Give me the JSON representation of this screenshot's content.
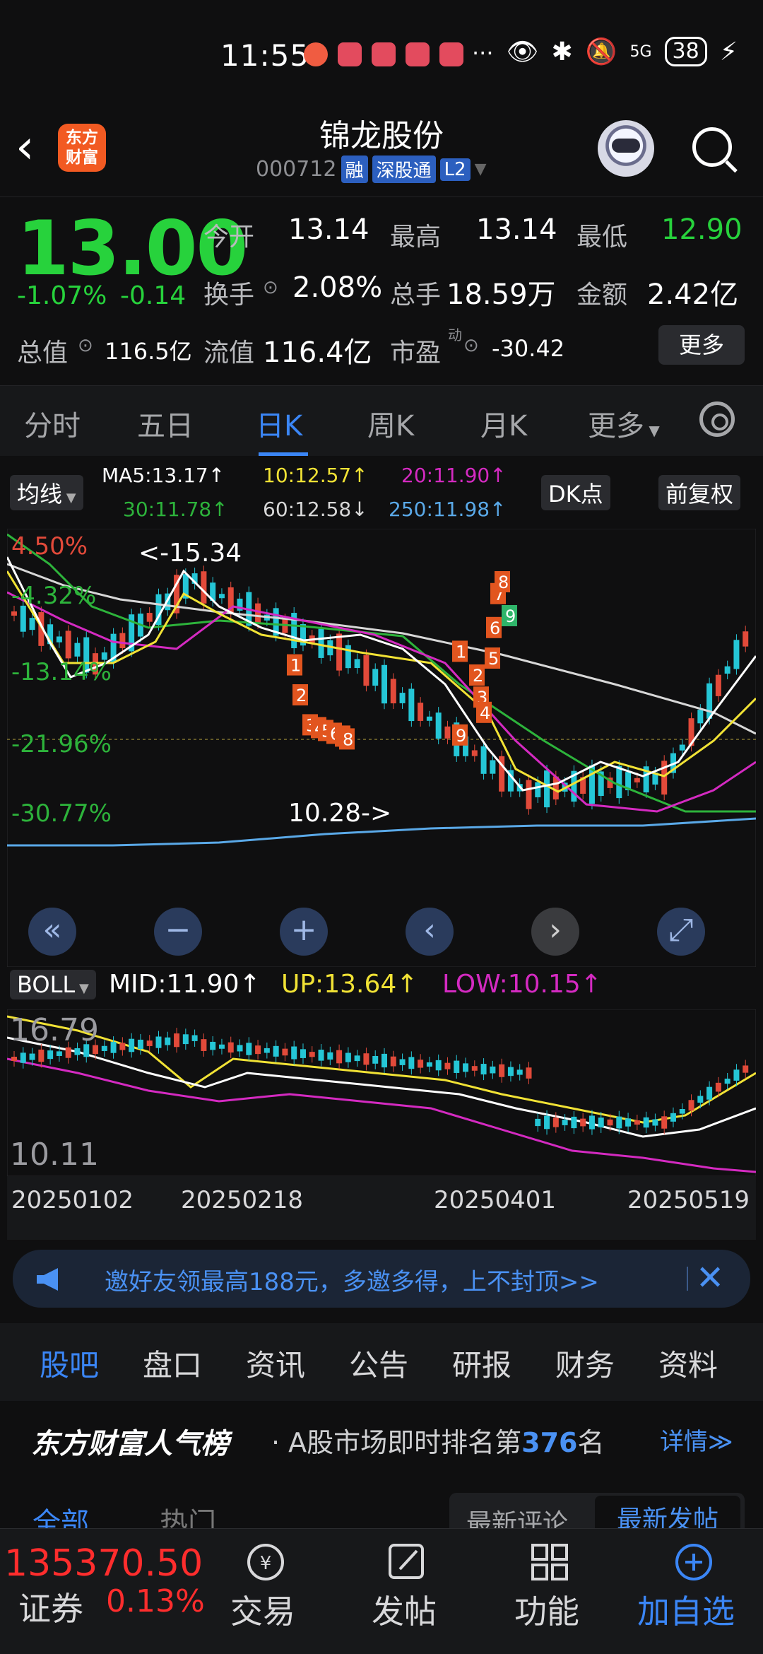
{
  "status": {
    "time": "11:55",
    "battery": "38",
    "network": "5G"
  },
  "header": {
    "brand_line1": "东方",
    "brand_line2": "财富",
    "title": "锦龙股份",
    "code": "000712",
    "tags": [
      "融",
      "深股通",
      "L2"
    ]
  },
  "quote": {
    "price": "13.00",
    "change_pct": "-1.07%",
    "change_amt": "-0.14",
    "open_label": "今开",
    "open": "13.14",
    "high_label": "最高",
    "high": "13.14",
    "low_label": "最低",
    "low": "12.90",
    "turnover_label": "换手",
    "turnover": "2.08%",
    "volume_label": "总手",
    "volume": "18.59万",
    "amount_label": "金额",
    "amount": "2.42亿",
    "mcap_label": "总值",
    "mcap": "116.5亿",
    "float_label": "流值",
    "float": "116.4亿",
    "pe_label": "市盈",
    "pe_sup": "动",
    "pe": "-30.42",
    "more": "更多"
  },
  "tabs": [
    "分时",
    "五日",
    "日K",
    "周K",
    "月K",
    "更多"
  ],
  "ma": {
    "selector": "均线",
    "ma5": "MA5:13.17↑",
    "ma10": "10:12.57↑",
    "ma20": "20:11.90↑",
    "ma30": "30:11.78↑",
    "ma60": "60:12.58↓",
    "ma250": "250:11.98↑",
    "dk_button": "DK点",
    "adjust_button": "前复权",
    "colors": {
      "ma5": "#ffffff",
      "ma10": "#f1e235",
      "ma20": "#d42ac1",
      "ma30": "#2db33b",
      "ma60": "#d7d7d7",
      "ma250": "#5aa9e8"
    }
  },
  "kchart": {
    "pct_labels": [
      "4.50%",
      "-4.32%",
      "-13.14%",
      "-21.96%",
      "-30.77%"
    ],
    "high_label": "<-15.34",
    "low_label": "10.28->",
    "markers": [
      "1",
      "2",
      "3",
      "4",
      "5",
      "6",
      "7",
      "8",
      "9"
    ]
  },
  "boll": {
    "selector": "BOLL",
    "mid": "MID:11.90↑",
    "up": "UP:13.64↑",
    "low": "LOW:10.15↑",
    "top": "16.79",
    "bottom": "10.11"
  },
  "dates": [
    "20250102",
    "20250218",
    "20250401",
    "20250519"
  ],
  "banner": {
    "text": "邀好友领最高188元，多邀多得，上不封顶>>"
  },
  "subtabs": [
    "股吧",
    "盘口",
    "资讯",
    "公告",
    "研报",
    "财务",
    "资料"
  ],
  "rank": {
    "title": "东方财富人气榜",
    "desc_prefix": "· A股市场即时排名第",
    "rank": "376",
    "desc_suffix": "名",
    "detail": "详情≫"
  },
  "filters": {
    "all": "全部",
    "hot": "热门",
    "latest_comment": "最新评论",
    "latest_post": "最新发帖"
  },
  "bottom": {
    "index_value": "135370.50",
    "index_name": "证券",
    "index_pct": "0.13%",
    "items": [
      "交易",
      "发帖",
      "功能",
      "加自选"
    ]
  }
}
